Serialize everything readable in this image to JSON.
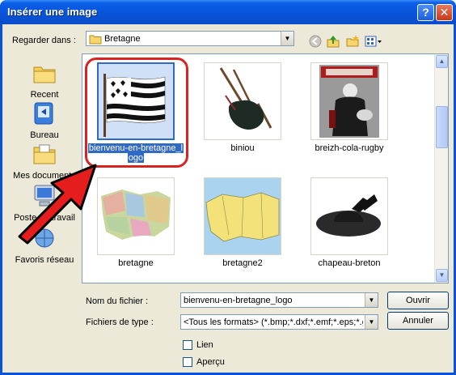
{
  "window": {
    "title": "Insérer une image",
    "help_glyph": "?",
    "close_glyph": "✕"
  },
  "lookin": {
    "label": "Regarder dans :",
    "value": "Bretagne"
  },
  "toolbar": {
    "back": "back-icon",
    "up": "up-folder-icon",
    "new_folder": "new-folder-icon",
    "views": "views-menu-icon"
  },
  "places": [
    {
      "label": "Recent",
      "icon": "recent-icon"
    },
    {
      "label": "Bureau",
      "icon": "desktop-icon"
    },
    {
      "label": "Mes documents",
      "icon": "my-documents-icon"
    },
    {
      "label": "Poste de travail",
      "icon": "my-computer-icon"
    },
    {
      "label": "Favoris réseau",
      "icon": "network-icon"
    }
  ],
  "files": [
    {
      "name": "bienvenu-en-bretagne_logo",
      "name_line1": "bienvenu-en-bretagne_l",
      "name_line2": "ogo",
      "selected": true,
      "thumb": "breton-flag"
    },
    {
      "name": "biniou",
      "selected": false,
      "thumb": "bagpipe"
    },
    {
      "name": "breizh-cola-rugby",
      "selected": false,
      "thumb": "cola-rugby-poster"
    },
    {
      "name": "bretagne",
      "selected": false,
      "thumb": "brittany-map"
    },
    {
      "name": "bretagne2",
      "selected": false,
      "thumb": "brittany-map-2"
    },
    {
      "name": "chapeau-breton",
      "selected": false,
      "thumb": "breton-hat"
    }
  ],
  "filename": {
    "label": "Nom du fichier :",
    "value": "bienvenu-en-bretagne_logo"
  },
  "filetype": {
    "label": "Fichiers de type :",
    "value": "<Tous les formats> (*.bmp;*.dxf;*.emf;*.eps;*.gif"
  },
  "buttons": {
    "open": "Ouvrir",
    "cancel": "Annuler"
  },
  "options": {
    "link": "Lien",
    "preview": "Aperçu"
  },
  "colors": {
    "title_bar": "#0854d9",
    "selection": "#316ac5",
    "highlight": "#d72323"
  }
}
